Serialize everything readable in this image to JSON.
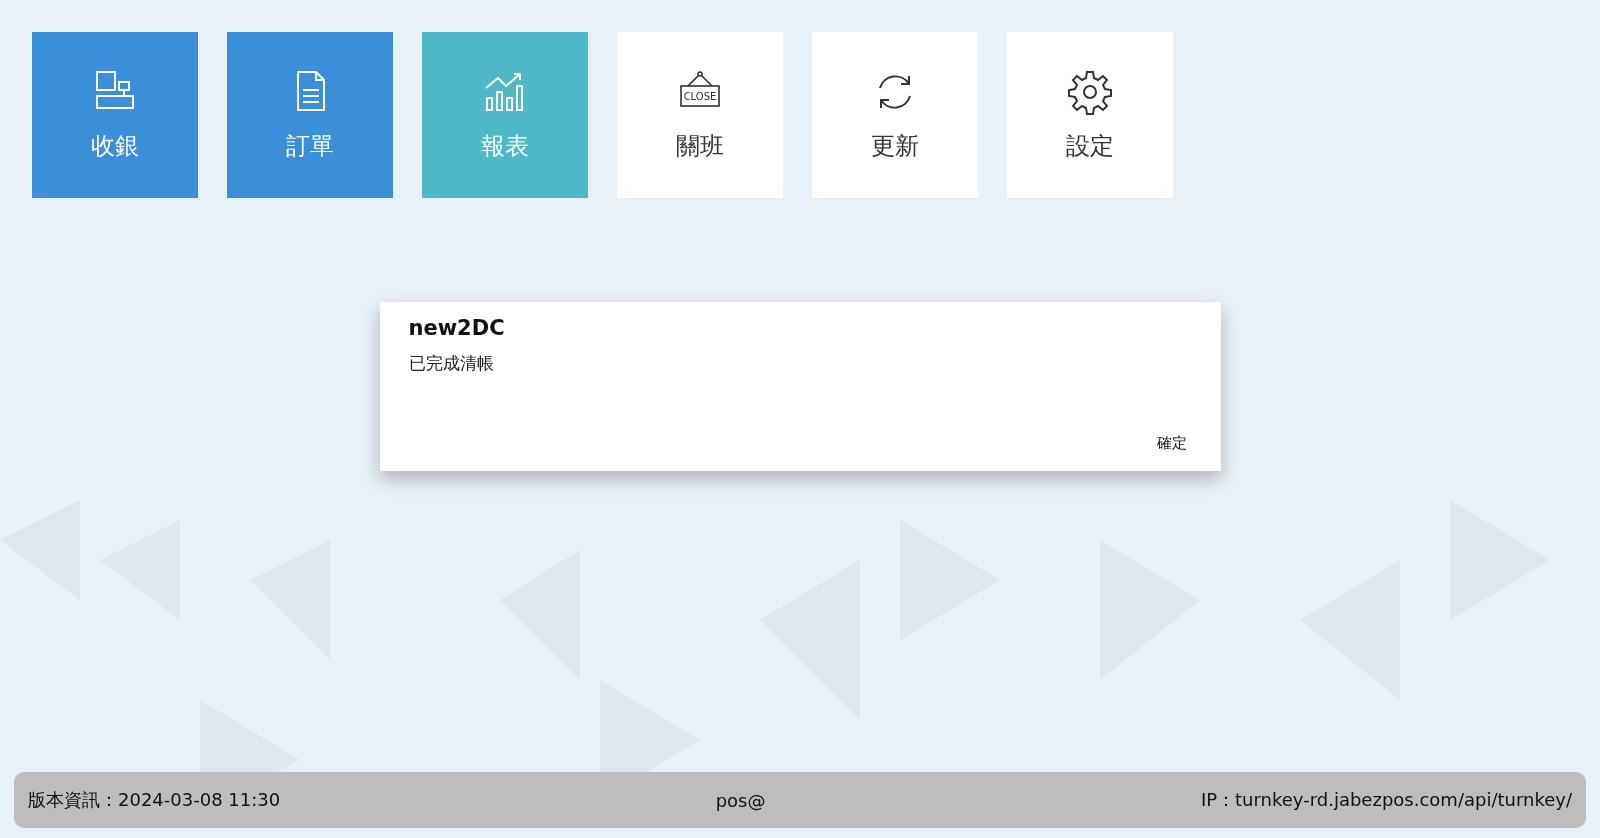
{
  "tiles": [
    {
      "label": "收銀",
      "kind": "filled",
      "color": "#3a8fd8"
    },
    {
      "label": "訂單",
      "kind": "filled",
      "color": "#3a8fd8"
    },
    {
      "label": "報表",
      "kind": "filled",
      "color": "#50b9c8"
    },
    {
      "label": "關班",
      "kind": "plain",
      "color": "#ffffff",
      "sign_text": "CLOSE"
    },
    {
      "label": "更新",
      "kind": "plain",
      "color": "#ffffff"
    },
    {
      "label": "設定",
      "kind": "plain",
      "color": "#ffffff"
    }
  ],
  "dialog": {
    "title": "new2DC",
    "message": "已完成清帳",
    "button": "確定"
  },
  "status_bar": {
    "version": "版本資訊：2024-03-08 11:30",
    "user": "pos@",
    "ip": "IP：turnkey-rd.jabezpos.com/api/turnkey/"
  }
}
